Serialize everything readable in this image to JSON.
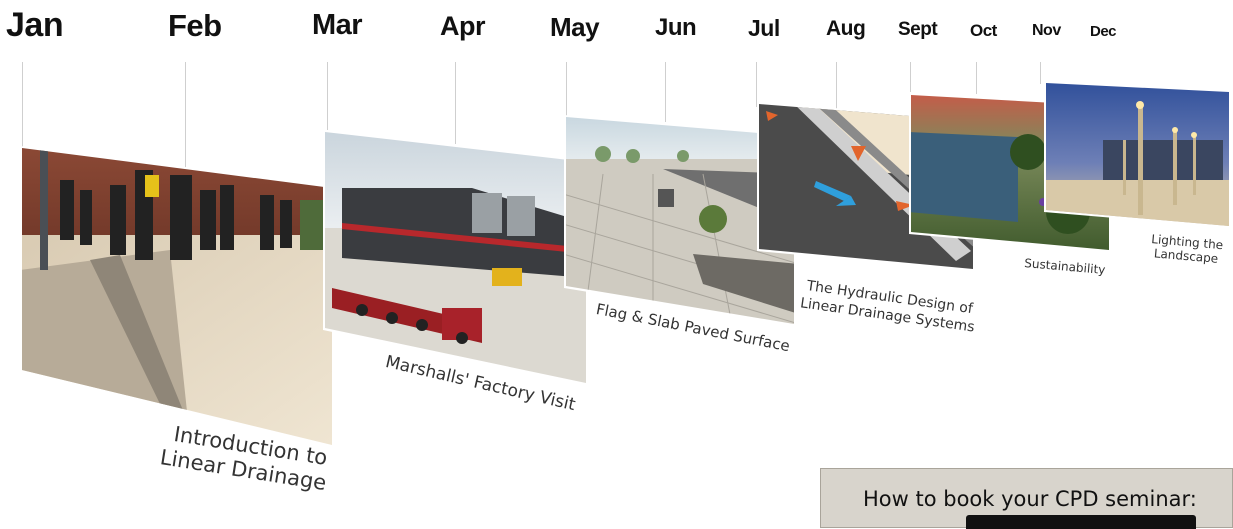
{
  "months": [
    "Jan",
    "Feb",
    "Mar",
    "Apr",
    "May",
    "Jun",
    "Jul",
    "Aug",
    "Sept",
    "Oct",
    "Nov",
    "Dec"
  ],
  "captions": {
    "intro": [
      "Introduction to",
      "Linear Drainage"
    ],
    "factory": "Marshalls' Factory Visit",
    "flag": "Flag & Slab Paved Surface",
    "hydraulic": [
      "The Hydraulic Design of",
      "Linear Drainage Systems"
    ],
    "sustain": "Sustainability",
    "lighting": [
      "Lighting the",
      "Landscape"
    ]
  },
  "booking": {
    "title": "How to book your CPD seminar:"
  }
}
